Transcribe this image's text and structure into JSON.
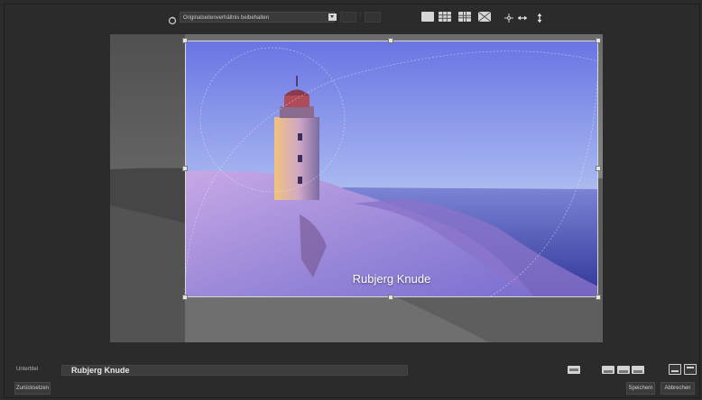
{
  "toolbar": {
    "aspect_ratio_value": "Originalseitenverhältnis beibehalten",
    "ratio_separator": ":",
    "icons": [
      "rotate-icon",
      "chevron-down-icon",
      "grid-1x1-icon",
      "grid-3x3-icon",
      "grid-golden-icon",
      "grid-diagonal-icon",
      "center-icon",
      "flip-horizontal-icon",
      "flip-vertical-icon"
    ]
  },
  "image": {
    "caption": "Rubjerg Knude"
  },
  "subtitle": {
    "label": "Untertitel",
    "value": "Rubjerg Knude"
  },
  "buttons": {
    "reset": "Zurücksetzen",
    "save": "Speichern",
    "cancel": "Abbrechen"
  },
  "colors": {
    "background": "#2b2b2b",
    "panel": "#3a3a3a",
    "sky_top": "#6f7ae6",
    "sky_horizon": "#f2d8a0",
    "sand": "#b89ad8",
    "sea": "#3b3fa8"
  }
}
